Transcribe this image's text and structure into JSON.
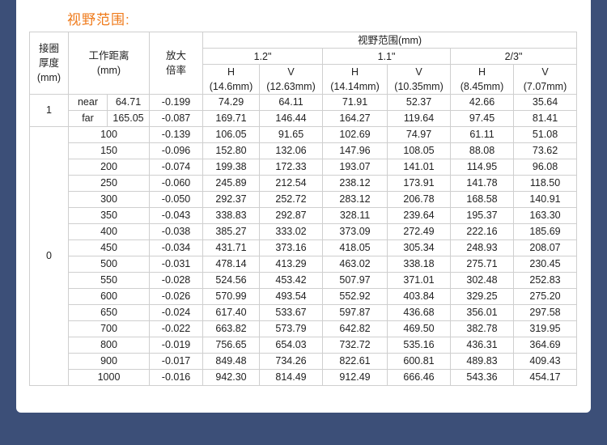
{
  "title": "视野范围:",
  "headers": {
    "thickness": [
      "接圈",
      "厚度",
      "(mm)"
    ],
    "distance": "工作距离",
    "distance_unit": "(mm)",
    "magnification": [
      "放大",
      "倍率"
    ],
    "fov": "视野范围(mm)",
    "sensors": [
      "1.2\"",
      "1.1\"",
      "2/3\""
    ],
    "axes": [
      {
        "axis": "H",
        "size": "(14.6mm)"
      },
      {
        "axis": "V",
        "size": "(12.63mm)"
      },
      {
        "axis": "H",
        "size": "(14.14mm)"
      },
      {
        "axis": "V",
        "size": "(10.35mm)"
      },
      {
        "axis": "H",
        "size": "(8.45mm)"
      },
      {
        "axis": "V",
        "size": "(7.07mm)"
      }
    ]
  },
  "group1": {
    "thickness": "1",
    "rows": [
      {
        "label": "near",
        "distance": "64.71",
        "mag": "-0.199",
        "vals": [
          "74.29",
          "64.11",
          "71.91",
          "52.37",
          "42.66",
          "35.64"
        ]
      },
      {
        "label": "far",
        "distance": "165.05",
        "mag": "-0.087",
        "vals": [
          "169.71",
          "146.44",
          "164.27",
          "119.64",
          "97.45",
          "81.41"
        ]
      }
    ]
  },
  "group0": {
    "thickness": "0",
    "rows": [
      {
        "distance": "100",
        "mag": "-0.139",
        "vals": [
          "106.05",
          "91.65",
          "102.69",
          "74.97",
          "61.11",
          "51.08"
        ]
      },
      {
        "distance": "150",
        "mag": "-0.096",
        "vals": [
          "152.80",
          "132.06",
          "147.96",
          "108.05",
          "88.08",
          "73.62"
        ]
      },
      {
        "distance": "200",
        "mag": "-0.074",
        "vals": [
          "199.38",
          "172.33",
          "193.07",
          "141.01",
          "114.95",
          "96.08"
        ]
      },
      {
        "distance": "250",
        "mag": "-0.060",
        "vals": [
          "245.89",
          "212.54",
          "238.12",
          "173.91",
          "141.78",
          "118.50"
        ]
      },
      {
        "distance": "300",
        "mag": "-0.050",
        "vals": [
          "292.37",
          "252.72",
          "283.12",
          "206.78",
          "168.58",
          "140.91"
        ]
      },
      {
        "distance": "350",
        "mag": "-0.043",
        "vals": [
          "338.83",
          "292.87",
          "328.11",
          "239.64",
          "195.37",
          "163.30"
        ]
      },
      {
        "distance": "400",
        "mag": "-0.038",
        "vals": [
          "385.27",
          "333.02",
          "373.09",
          "272.49",
          "222.16",
          "185.69"
        ]
      },
      {
        "distance": "450",
        "mag": "-0.034",
        "vals": [
          "431.71",
          "373.16",
          "418.05",
          "305.34",
          "248.93",
          "208.07"
        ]
      },
      {
        "distance": "500",
        "mag": "-0.031",
        "vals": [
          "478.14",
          "413.29",
          "463.02",
          "338.18",
          "275.71",
          "230.45"
        ]
      },
      {
        "distance": "550",
        "mag": "-0.028",
        "vals": [
          "524.56",
          "453.42",
          "507.97",
          "371.01",
          "302.48",
          "252.83"
        ]
      },
      {
        "distance": "600",
        "mag": "-0.026",
        "vals": [
          "570.99",
          "493.54",
          "552.92",
          "403.84",
          "329.25",
          "275.20"
        ]
      },
      {
        "distance": "650",
        "mag": "-0.024",
        "vals": [
          "617.40",
          "533.67",
          "597.87",
          "436.68",
          "356.01",
          "297.58"
        ]
      },
      {
        "distance": "700",
        "mag": "-0.022",
        "vals": [
          "663.82",
          "573.79",
          "642.82",
          "469.50",
          "382.78",
          "319.95"
        ]
      },
      {
        "distance": "800",
        "mag": "-0.019",
        "vals": [
          "756.65",
          "654.03",
          "732.72",
          "535.16",
          "436.31",
          "364.69"
        ]
      },
      {
        "distance": "900",
        "mag": "-0.017",
        "vals": [
          "849.48",
          "734.26",
          "822.61",
          "600.81",
          "489.83",
          "409.43"
        ]
      },
      {
        "distance": "1000",
        "mag": "-0.016",
        "vals": [
          "942.30",
          "814.49",
          "912.49",
          "666.46",
          "543.36",
          "454.17"
        ]
      }
    ]
  }
}
